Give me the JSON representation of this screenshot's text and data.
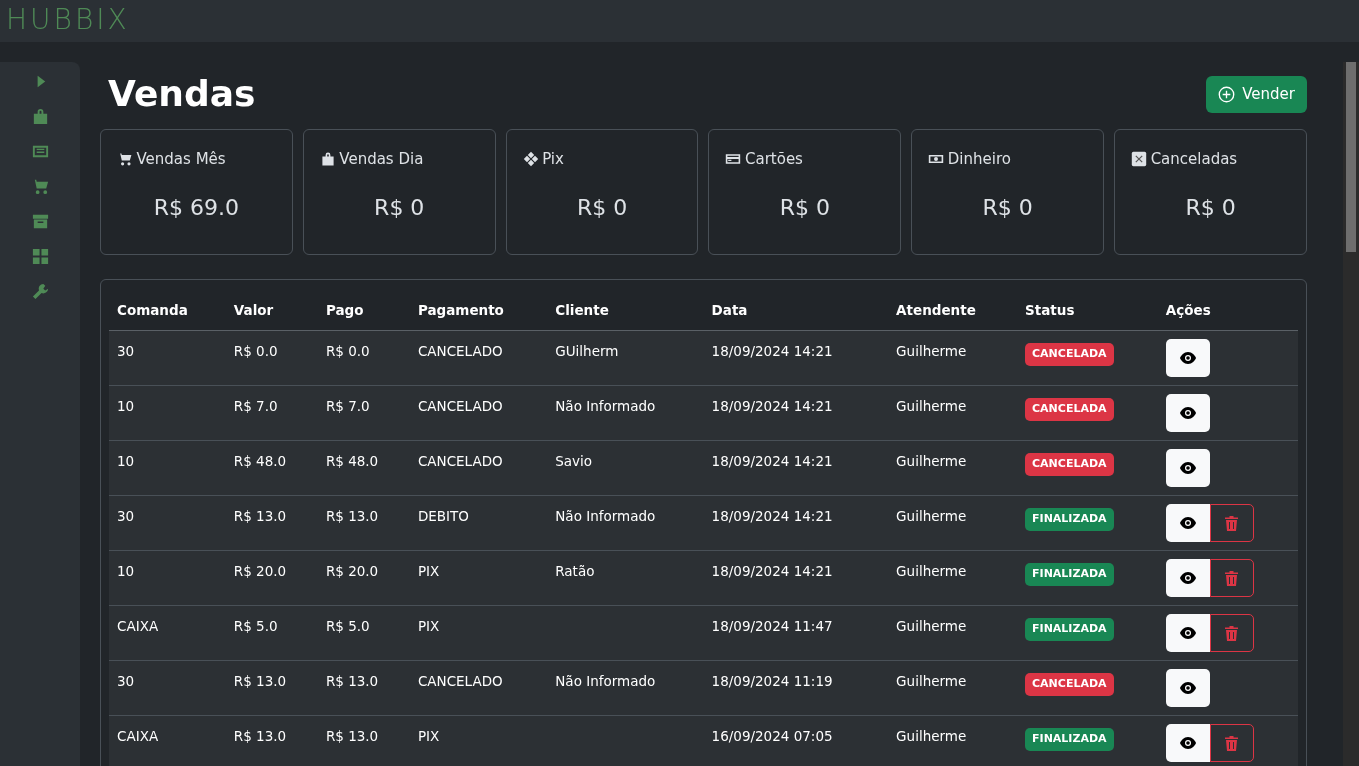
{
  "brand": "HUBBIX",
  "title": "Vendas",
  "new_button": "Vender",
  "stats": [
    {
      "label": "Vendas Mês",
      "value": "R$ 69.0"
    },
    {
      "label": "Vendas Dia",
      "value": "R$ 0"
    },
    {
      "label": "Pix",
      "value": "R$ 0"
    },
    {
      "label": "Cartões",
      "value": "R$ 0"
    },
    {
      "label": "Dinheiro",
      "value": "R$ 0"
    },
    {
      "label": "Canceladas",
      "value": "R$ 0"
    }
  ],
  "table": {
    "columns": [
      "Comanda",
      "Valor",
      "Pago",
      "Pagamento",
      "Cliente",
      "Data",
      "Atendente",
      "Status",
      "Ações"
    ],
    "rows": [
      {
        "cells": [
          "30",
          "R$ 0.0",
          "R$ 0.0",
          "CANCELADO",
          "GUilherm",
          "18/09/2024 14:21",
          "Guilherme"
        ],
        "status": {
          "kind": "cancelled",
          "text": "CANCELADA"
        },
        "deletable": false
      },
      {
        "cells": [
          "10",
          "R$ 7.0",
          "R$ 7.0",
          "CANCELADO",
          "Não Informado",
          "18/09/2024 14:21",
          "Guilherme"
        ],
        "status": {
          "kind": "cancelled",
          "text": "CANCELADA"
        },
        "deletable": false
      },
      {
        "cells": [
          "10",
          "R$ 48.0",
          "R$ 48.0",
          "CANCELADO",
          "Savio",
          "18/09/2024 14:21",
          "Guilherme"
        ],
        "status": {
          "kind": "cancelled",
          "text": "CANCELADA"
        },
        "deletable": false
      },
      {
        "cells": [
          "30",
          "R$ 13.0",
          "R$ 13.0",
          "DEBITO",
          "Não Informado",
          "18/09/2024 14:21",
          "Guilherme"
        ],
        "status": {
          "kind": "finished",
          "text": "FINALIZADA"
        },
        "deletable": true
      },
      {
        "cells": [
          "10",
          "R$ 20.0",
          "R$ 20.0",
          "PIX",
          "Ratão",
          "18/09/2024 14:21",
          "Guilherme"
        ],
        "status": {
          "kind": "finished",
          "text": "FINALIZADA"
        },
        "deletable": true
      },
      {
        "cells": [
          "CAIXA",
          "R$ 5.0",
          "R$ 5.0",
          "PIX",
          "",
          "18/09/2024 11:47",
          "Guilherme"
        ],
        "status": {
          "kind": "finished",
          "text": "FINALIZADA"
        },
        "deletable": true
      },
      {
        "cells": [
          "30",
          "R$ 13.0",
          "R$ 13.0",
          "CANCELADO",
          "Não Informado",
          "18/09/2024 11:19",
          "Guilherme"
        ],
        "status": {
          "kind": "cancelled",
          "text": "CANCELADA"
        },
        "deletable": false
      },
      {
        "cells": [
          "CAIXA",
          "R$ 13.0",
          "R$ 13.0",
          "PIX",
          "",
          "16/09/2024 07:05",
          "Guilherme"
        ],
        "status": {
          "kind": "finished",
          "text": "FINALIZADA"
        },
        "deletable": true
      }
    ]
  }
}
